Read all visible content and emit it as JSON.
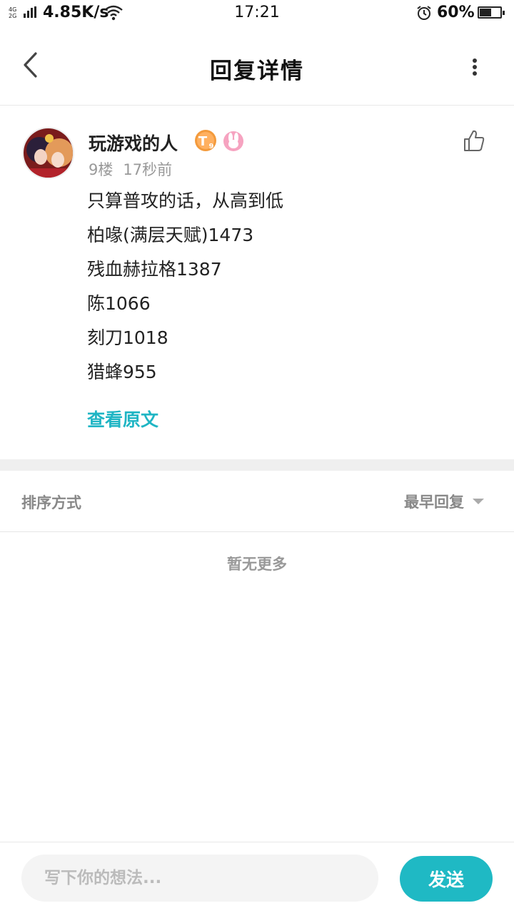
{
  "status_bar": {
    "network_top": "4G",
    "network_bottom": "2G",
    "speed": "4.85K/s",
    "time": "17:21",
    "battery_percent": "60%",
    "battery_level": 0.6
  },
  "header": {
    "title": "回复详情"
  },
  "post": {
    "username": "玩游戏的人",
    "level_badge": "T",
    "level_sub": "9",
    "floor": "9楼",
    "time_ago": "17秒前",
    "content_lines": [
      "只算普攻的话，从高到低",
      "柏喙(满层天赋)1473",
      "残血赫拉格1387",
      "陈1066",
      "刻刀1018",
      "猎蜂955"
    ],
    "view_original": "查看原文",
    "accent_color": "#1fb5c4"
  },
  "sort": {
    "label": "排序方式",
    "value": "最早回复"
  },
  "list": {
    "empty_text": "暂无更多"
  },
  "composer": {
    "placeholder": "写下你的想法...",
    "send_label": "发送",
    "send_color": "#1fb9c4"
  }
}
